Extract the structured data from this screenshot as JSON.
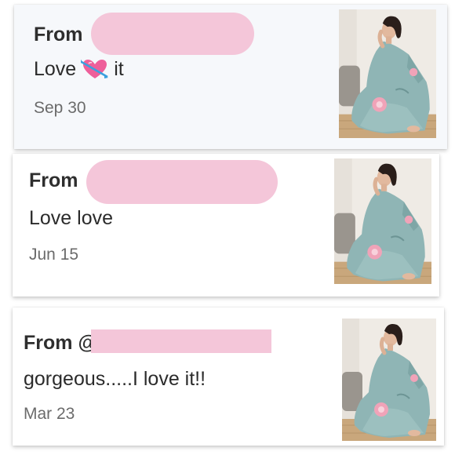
{
  "notifications": [
    {
      "from_label": "From",
      "message_before": "Love",
      "message_emoji": "heart-with-arrow-icon",
      "message_after": "it",
      "date": "Sep 30",
      "thumbnail": "woman-in-floral-pajamas-photo"
    },
    {
      "from_label": "From",
      "message": "Love love",
      "date": "Jun 15",
      "thumbnail": "woman-in-floral-pajamas-photo"
    },
    {
      "from_label": "From @",
      "message": "gorgeous.....I love it!!",
      "date": "Mar 23",
      "thumbnail": "woman-in-floral-pajamas-photo"
    }
  ],
  "colors": {
    "redaction": "#f4c6d9",
    "card_highlight": "#f6f8fb",
    "pajama": "#8fb5b5",
    "flower": "#f0a3b8"
  }
}
